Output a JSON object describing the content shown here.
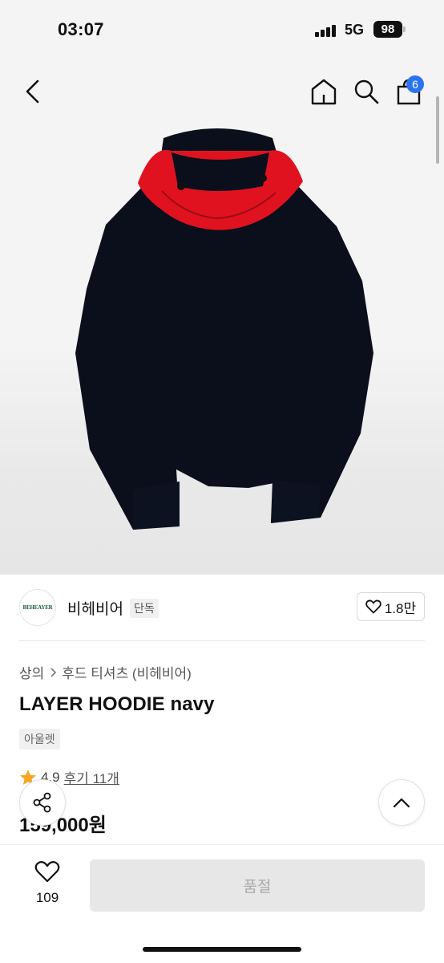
{
  "status_bar": {
    "time": "03:07",
    "network": "5G",
    "battery": "98"
  },
  "nav": {
    "bag_count": "6"
  },
  "brand": {
    "logo_text": "BEHEAYER",
    "name": "비헤비어",
    "tag": "단독",
    "likes": "1.8만"
  },
  "product": {
    "breadcrumb": [
      "상의",
      "후드 티셔츠 (비헤비어)"
    ],
    "title": "LAYER HOODIE navy",
    "badge": "아울렛",
    "rating": "4.9",
    "reviews": "후기 11개",
    "price": "159,000원",
    "image_colors": {
      "body": "#0b0f1c",
      "hood_lining": "#e0121f"
    }
  },
  "bottom": {
    "wish_count": "109",
    "buy_label": "품절"
  }
}
